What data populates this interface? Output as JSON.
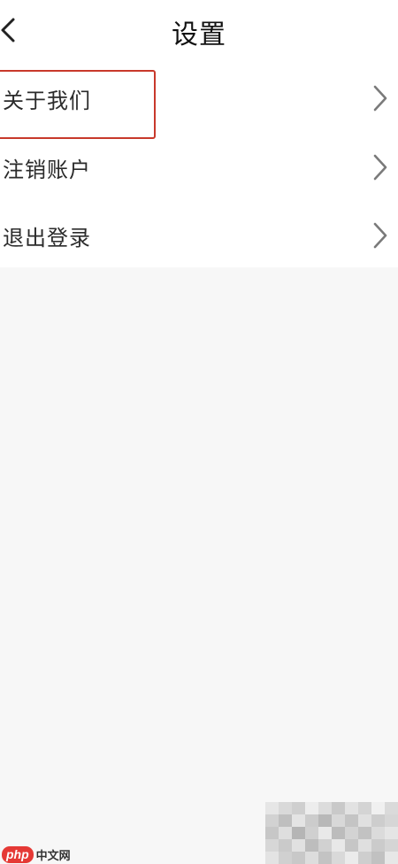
{
  "header": {
    "title": "设置",
    "back_icon": "chevron-left-icon"
  },
  "menu": {
    "items": [
      {
        "label": "关于我们",
        "icon": "chevron-right-icon",
        "highlighted": true
      },
      {
        "label": "注销账户",
        "icon": "chevron-right-icon"
      },
      {
        "label": "退出登录",
        "icon": "chevron-right-icon"
      }
    ]
  },
  "colors": {
    "highlight_border": "#c8392b",
    "background": "#f7f7f7",
    "chevron": "#7a7a7a",
    "watermark_badge": "#e53935"
  },
  "watermark": {
    "badge": "php",
    "text": "中文网"
  }
}
